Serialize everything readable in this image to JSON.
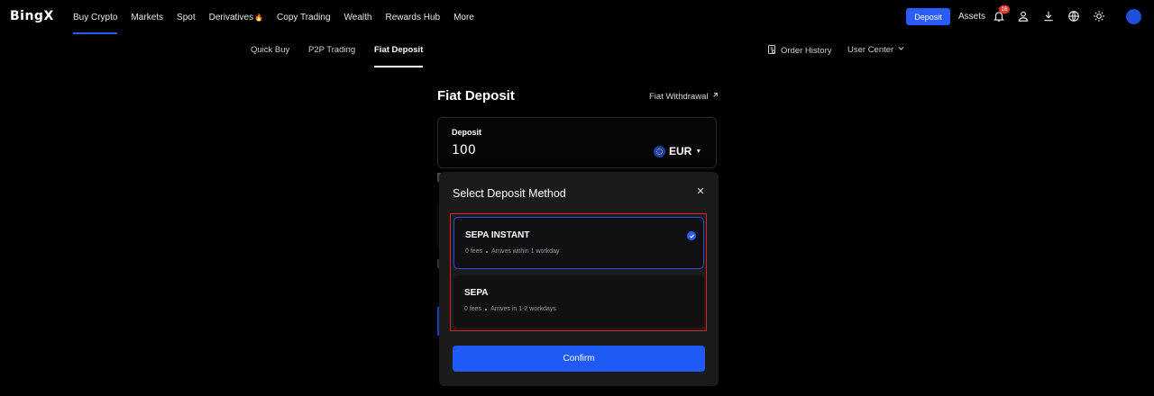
{
  "header": {
    "logo": "BingX",
    "nav": [
      {
        "label": "Buy Crypto",
        "active": true
      },
      {
        "label": "Markets"
      },
      {
        "label": "Spot"
      },
      {
        "label": "Derivatives"
      },
      {
        "label": "Copy Trading"
      },
      {
        "label": "Wealth"
      },
      {
        "label": "Rewards Hub"
      },
      {
        "label": "More"
      }
    ],
    "deposit_label": "Deposit",
    "assets_label": "Assets",
    "notification_count": "16",
    "icons": [
      "bell-icon",
      "user-icon",
      "download-icon",
      "globe-icon",
      "sun-icon",
      "avatar"
    ]
  },
  "subnav": {
    "tabs": [
      {
        "label": "Quick Buy"
      },
      {
        "label": "P2P Trading"
      },
      {
        "label": "Fiat Deposit",
        "active": true
      }
    ],
    "order_history": "Order History",
    "user_center": "User Center"
  },
  "main": {
    "title": "Fiat Deposit",
    "withdraw_link": "Fiat Withdrawal",
    "deposit_label": "Deposit",
    "amount": "100",
    "currency": "EUR"
  },
  "modal": {
    "title": "Select Deposit Method",
    "methods": [
      {
        "name": "SEPA INSTANT",
        "fees": "0 fees",
        "arrival": "Arrives within 1 workday",
        "selected": true
      },
      {
        "name": "SEPA",
        "fees": "0 fees",
        "arrival": "Arrives in 1-2 workdays",
        "selected": false
      }
    ],
    "confirm_label": "Confirm"
  },
  "colors": {
    "background": "#000000",
    "accent": "#2a5cff",
    "modal_bg": "#1b1b1b",
    "highlight_border": "#e02020",
    "badge": "#e53935"
  }
}
